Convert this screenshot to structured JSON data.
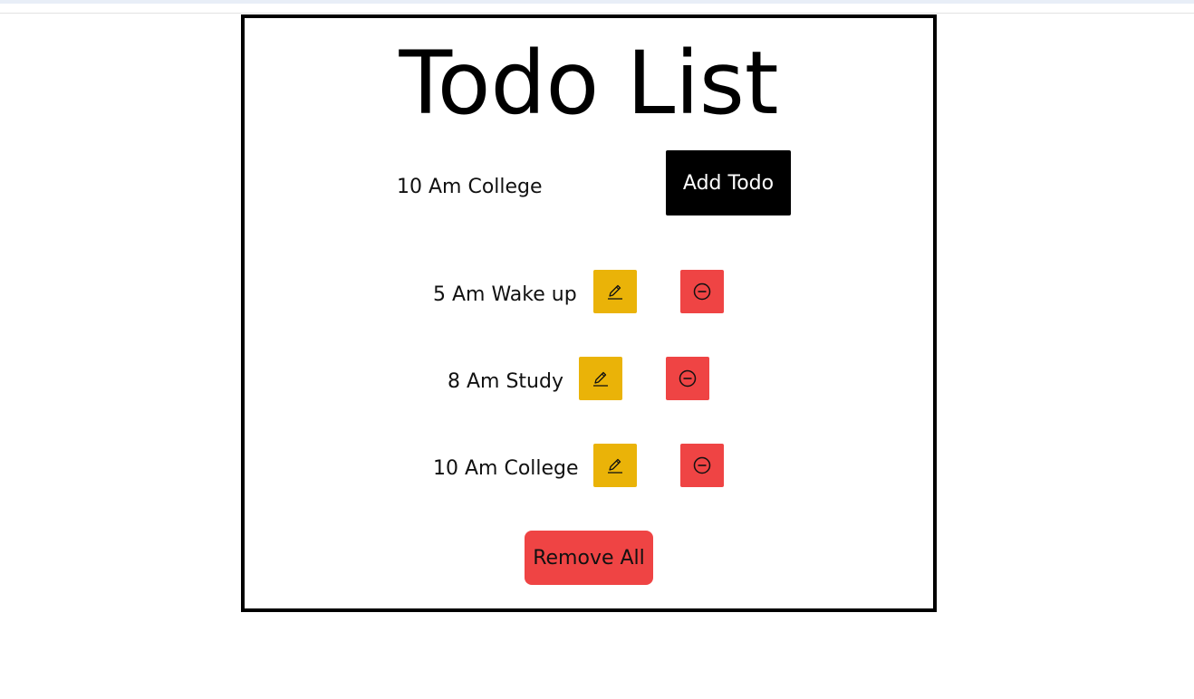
{
  "app": {
    "title": "Todo List"
  },
  "input": {
    "value": "10 Am College"
  },
  "buttons": {
    "add_label": "Add Todo",
    "remove_all_label": "Remove All"
  },
  "todos": [
    {
      "text": "5 Am Wake up"
    },
    {
      "text": "8 Am Study"
    },
    {
      "text": "10 Am College"
    }
  ],
  "icons": {
    "edit": "pencil-icon",
    "delete": "minus-circle-icon"
  },
  "colors": {
    "edit_button": "#eab308",
    "delete_button": "#ef4444",
    "add_button": "#000000",
    "card_border": "#000000"
  }
}
